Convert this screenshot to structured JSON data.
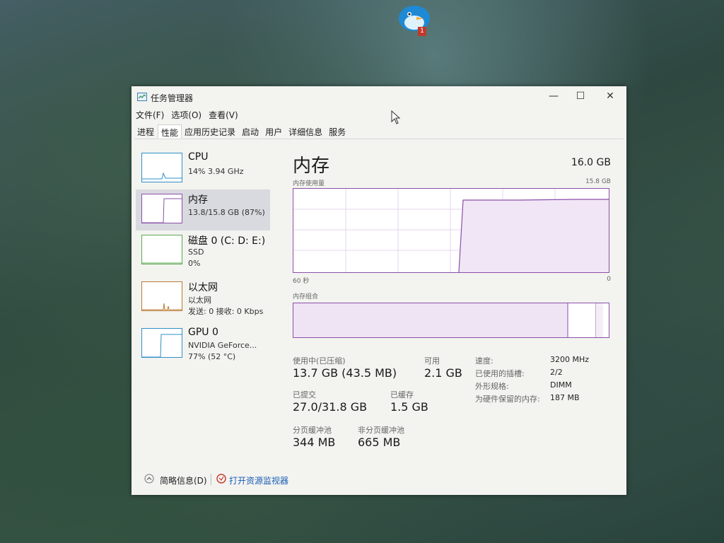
{
  "desktop": {
    "badge_count": "1"
  },
  "window": {
    "title": "任务管理器",
    "controls": {
      "minimize": "—",
      "maximize": "☐",
      "close": "✕"
    }
  },
  "menu": [
    "文件(F)",
    "选项(O)",
    "查看(V)"
  ],
  "tabs": [
    "进程",
    "性能",
    "应用历史记录",
    "启动",
    "用户",
    "详细信息",
    "服务"
  ],
  "active_tab": "性能",
  "sidebar": {
    "cpu": {
      "name": "CPU",
      "line1": "14% 3.94 GHz"
    },
    "mem": {
      "name": "内存",
      "line1": "13.8/15.8 GB (87%)"
    },
    "disk": {
      "name": "磁盘 0 (C: D: E:)",
      "line1": "SSD",
      "line2": "0%"
    },
    "eth": {
      "name": "以太网",
      "line1": "以太网",
      "line2": "发送: 0 接收: 0 Kbps"
    },
    "gpu": {
      "name": "GPU 0",
      "line1": "NVIDIA GeForce...",
      "line2": "77% (52 °C)"
    }
  },
  "main": {
    "title": "内存",
    "total": "16.0 GB",
    "usage_label": "内存使用量",
    "usage_max": "15.8 GB",
    "time_left": "60 秒",
    "time_right": "0",
    "composition_label": "内存组合",
    "stats": {
      "in_use_label": "使用中(已压缩)",
      "in_use": "13.7 GB (43.5 MB)",
      "available_label": "可用",
      "available": "2.1 GB",
      "committed_label": "已提交",
      "committed": "27.0/31.8 GB",
      "cached_label": "已缓存",
      "cached": "1.5 GB",
      "paged_label": "分页缓冲池",
      "paged": "344 MB",
      "nonpaged_label": "非分页缓冲池",
      "nonpaged": "665 MB"
    },
    "details": [
      {
        "key": "速度:",
        "value": "3200 MHz"
      },
      {
        "key": "已使用的插槽:",
        "value": "2/2"
      },
      {
        "key": "外形规格:",
        "value": "DIMM"
      },
      {
        "key": "为硬件保留的内存:",
        "value": "187 MB"
      }
    ]
  },
  "footer": {
    "fewer_details": "简略信息(D)",
    "open_monitor": "打开资源监视器"
  },
  "colors": {
    "memory_accent": "#8b4fa8",
    "cpu_accent": "#2f8fc7",
    "link": "#1a5fb4"
  }
}
